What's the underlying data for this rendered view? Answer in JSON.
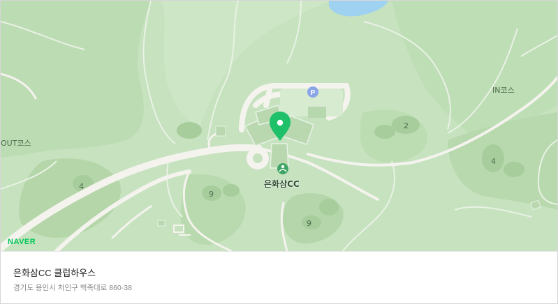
{
  "map": {
    "poi_label": "은화삼CC",
    "course_labels": {
      "in": "IN코스",
      "out": "OUT코스"
    },
    "hole_numbers": {
      "hole_2": "2",
      "hole_4_right": "4",
      "hole_4_left": "4",
      "hole_9_left": "9",
      "hole_9_right": "9"
    },
    "parking_symbol": "P",
    "brand": "NAVER",
    "colors": {
      "land": "#c6e2bf",
      "fairway": "#b4d7a9",
      "road": "#f5f3ee",
      "water": "#9fd1f1",
      "marker": "#1fc06a",
      "parking": "#8aa4e6",
      "brand": "#03c75a"
    }
  },
  "info": {
    "title": "은화삼CC 클럽하우스",
    "address": "경기도 용인시 처인구 백족대로 860-38"
  }
}
